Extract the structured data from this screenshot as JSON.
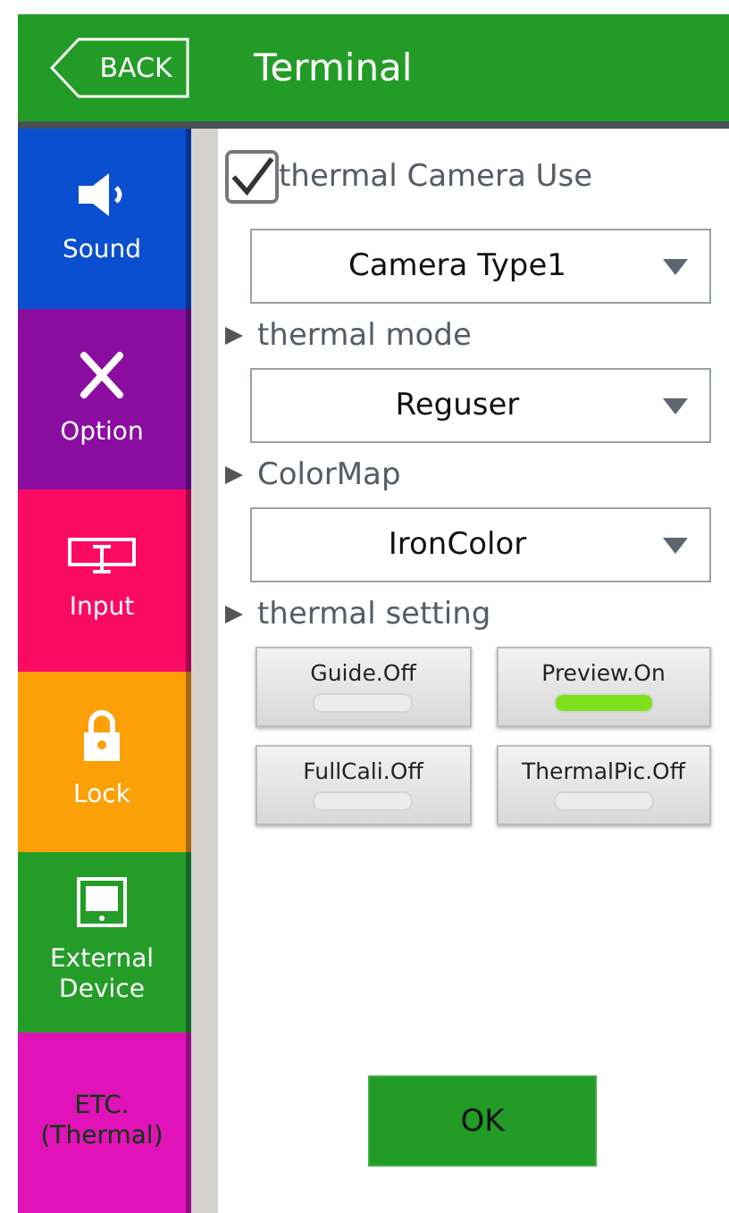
{
  "header": {
    "back": "BACK",
    "title": "Terminal"
  },
  "sidebar": {
    "items": [
      {
        "label": "Sound",
        "color": "#0a4fd0",
        "selected": false
      },
      {
        "label": "Option",
        "color": "#8b0da0",
        "selected": false
      },
      {
        "label": "Input",
        "color": "#fb0a64",
        "selected": false
      },
      {
        "label": "Lock",
        "color": "#fca008",
        "selected": false
      },
      {
        "label": "External Device",
        "color": "#239d27",
        "selected": false
      },
      {
        "label": "ETC.\n(Thermal)",
        "color": "#e012b8",
        "selected": true
      }
    ]
  },
  "camera_use": {
    "label": "thermal Camera Use",
    "checked": true
  },
  "camera_type": {
    "value": "Camera Type1"
  },
  "sections": [
    {
      "heading": "thermal mode",
      "value": "Reguser"
    },
    {
      "heading": "ColorMap",
      "value": "IronColor"
    }
  ],
  "settings": {
    "heading": "thermal setting",
    "toggles": [
      {
        "label": "Guide.Off",
        "on": false
      },
      {
        "label": "Preview.On",
        "on": true
      },
      {
        "label": "FullCali.Off",
        "on": false
      },
      {
        "label": "ThermalPic.Off",
        "on": false
      }
    ]
  },
  "ok": "OK"
}
